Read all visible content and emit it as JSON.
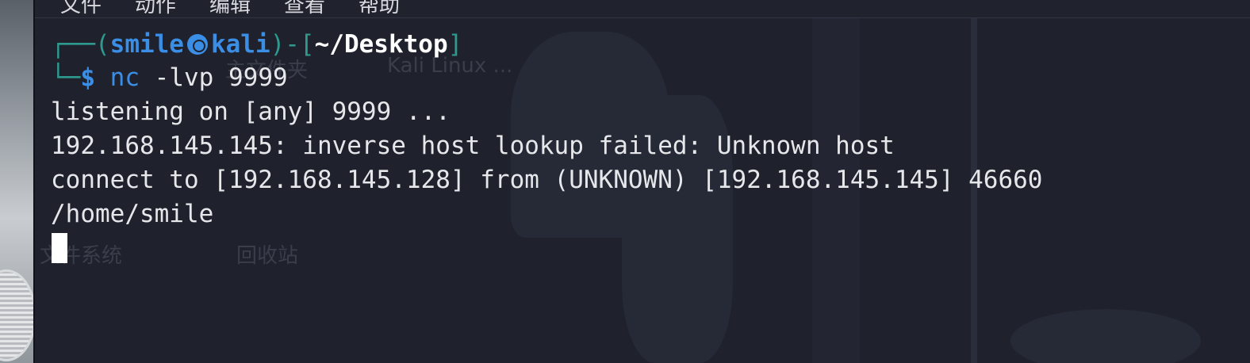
{
  "menubar": {
    "items": [
      "文件",
      "动作",
      "编辑",
      "查看",
      "帮助"
    ]
  },
  "prompt": {
    "frame_open": "┌──(",
    "user": "smile",
    "host": "kali",
    "frame_mid": ")-[",
    "path": "~/Desktop",
    "frame_close": "]",
    "frame_down": "└─",
    "symbol": "$",
    "command": "nc",
    "args": "-lvp 9999"
  },
  "output": {
    "lines": [
      "listening on [any] 9999 ...",
      "192.168.145.145: inverse host lookup failed: Unknown host",
      "connect to [192.168.145.128] from (UNKNOWN) [192.168.145.145] 46660",
      "/home/smile"
    ]
  },
  "desktop_ghost_labels": [
    "主文件夹",
    "Kali Linux ...",
    "文件系统",
    "回收站"
  ],
  "colors": {
    "background": "#1f222d",
    "prompt_frame": "#2e9a8f",
    "prompt_user": "#3a8ee6",
    "text": "#e6e7ea"
  }
}
